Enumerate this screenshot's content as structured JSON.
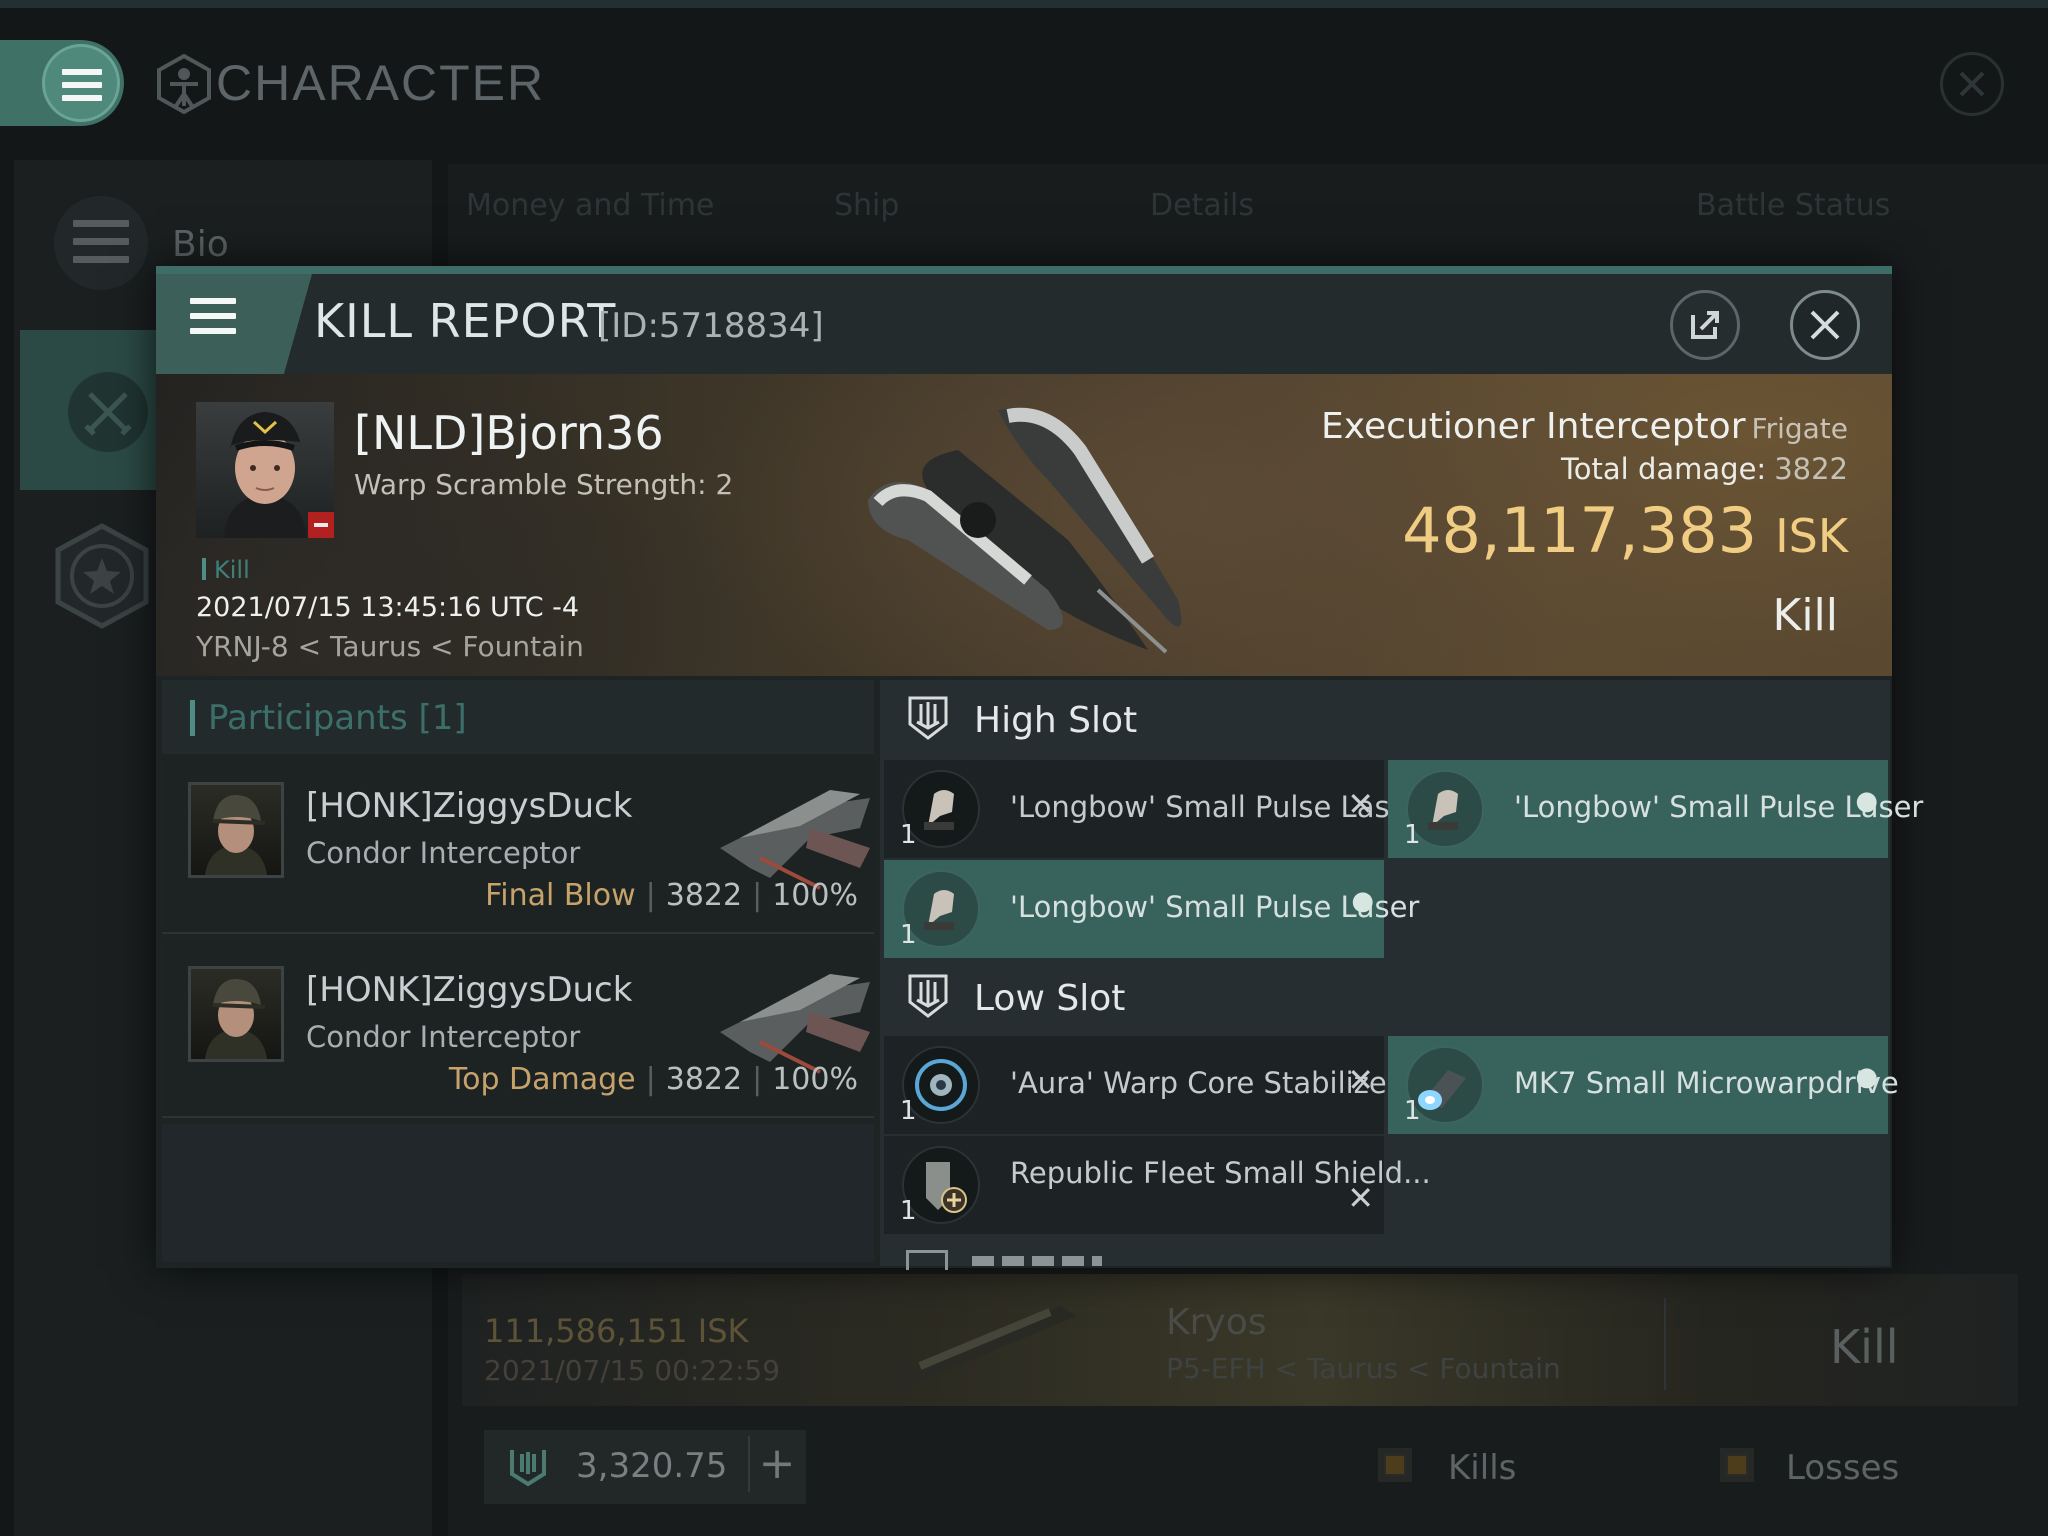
{
  "background_window": {
    "title": "CHARACTER",
    "sidebar": {
      "bio_label": "Bio"
    },
    "tabs": [
      "Money and Time",
      "Ship",
      "Details",
      "Battle Status"
    ],
    "row": {
      "isk": "111,586,151  ISK",
      "date": "2021/07/15  00:22:59",
      "ship": "Kryos",
      "location": "P5-EFH < Taurus < Fountain",
      "result": "Kill"
    },
    "footer": {
      "skill_points": "3,320.75",
      "plus_label": "+",
      "kills_label": "Kills",
      "losses_label": "Losses"
    }
  },
  "dialog": {
    "title": "KILL REPORT",
    "id": "[ID:5718834]",
    "victim": {
      "name": "[NLD]Bjorn36",
      "subtitle": "Warp Scramble Strength: 2",
      "tag": "Kill",
      "datetime": "2021/07/15 13:45:16 UTC -4",
      "location": "YRNJ-8 < Taurus < Fountain"
    },
    "ship": {
      "name": "Executioner Interceptor",
      "class": "Frigate",
      "total_damage_label": "Total damage:",
      "total_damage": "3822",
      "isk_value": "48,117,383",
      "isk_unit": "ISK",
      "result": "Kill"
    },
    "participants": {
      "title": "Participants [1]",
      "items": [
        {
          "name": "[HONK]ZiggysDuck",
          "ship": "Condor Interceptor",
          "role": "Final Blow",
          "damage": "3822",
          "percent": "100%"
        },
        {
          "name": "[HONK]ZiggysDuck",
          "ship": "Condor Interceptor",
          "role": "Top Damage",
          "damage": "3822",
          "percent": "100%"
        }
      ]
    },
    "fitting": {
      "high_slot": {
        "title": "High Slot",
        "modules": [
          {
            "name": "'Longbow' Small Pulse Laser",
            "qty": "1",
            "state": "destroyed"
          },
          {
            "name": "'Longbow' Small Pulse Laser",
            "qty": "1",
            "state": "dropped"
          },
          {
            "name": "'Longbow' Small Pulse Laser",
            "qty": "1",
            "state": "dropped"
          }
        ]
      },
      "low_slot": {
        "title": "Low Slot",
        "modules": [
          {
            "name": "'Aura' Warp Core Stabilizer",
            "qty": "1",
            "state": "destroyed"
          },
          {
            "name": "MK7 Small Microwarpdrive",
            "qty": "1",
            "state": "dropped"
          },
          {
            "name": "Republic Fleet Small Shield...",
            "qty": "1",
            "state": "destroyed"
          }
        ]
      }
    }
  },
  "colors": {
    "accent": "#3e6d68",
    "fitted_module": "#38625c",
    "isk_gold": "#f1cd84",
    "role_gold": "#c6a36b"
  }
}
